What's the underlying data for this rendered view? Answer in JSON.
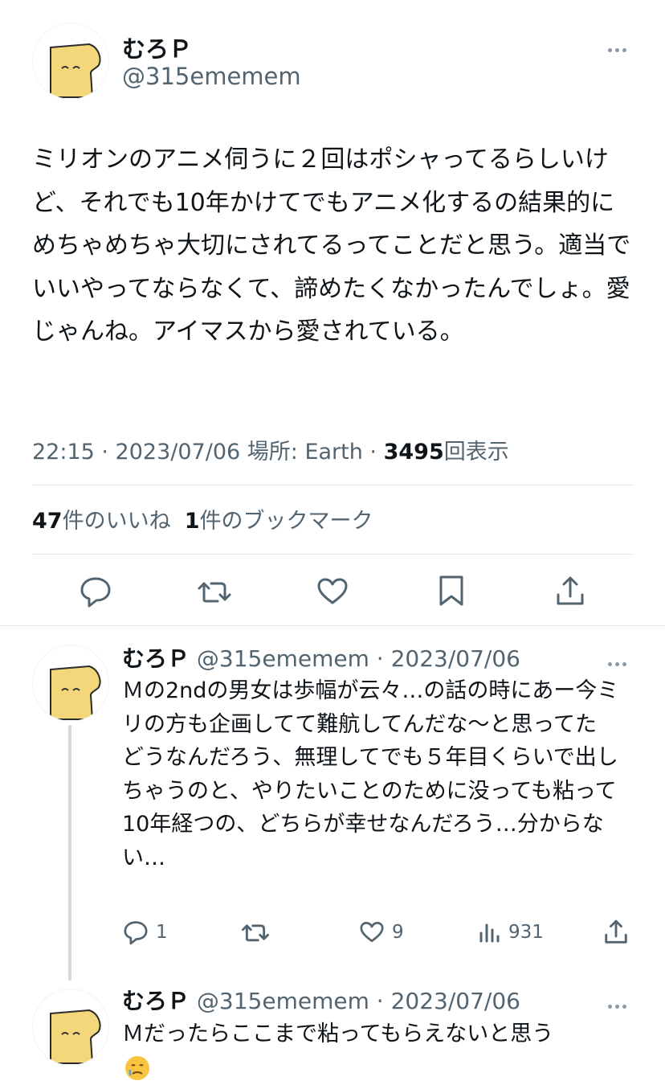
{
  "main_tweet": {
    "name": "むろＰ",
    "handle": "@315ememem",
    "body": "ミリオンのアニメ伺うに２回はポシャってるらしいけど、それでも10年かけてでもアニメ化するの結果的にめちゃめちゃ大切にされてるってことだと思う。適当でいいやってならなくて、諦めたくなかったんでしょ。愛じゃんね。アイマスから愛されている。",
    "meta_prefix": "22:15 · 2023/07/06 場所: Earth · ",
    "views": "3495",
    "views_label": "回表示",
    "likes_count": "47",
    "likes_label": "件のいいね",
    "bookmarks_count": "1",
    "bookmarks_label": "件のブックマーク",
    "actions": [
      "reply-icon",
      "retweet-icon",
      "like-icon",
      "bookmark-icon",
      "share-icon"
    ]
  },
  "replies": [
    {
      "name": "むろＰ",
      "handle": "@315ememem",
      "date": "· 2023/07/06",
      "body": "Ｍの2ndの男女は歩幅が云々…の話の時にあー今ミリの方も企画してて難航してんだな〜と思ってた\nどうなんだろう、無理してでも５年目くらいで出しちゃうのと、やりたいことのために没っても粘って10年経つの、どちらが幸せなんだろう…分からない…",
      "reply_count": "1",
      "like_count": "9",
      "view_count": "931"
    },
    {
      "name": "むろＰ",
      "handle": "@315ememem",
      "date": "· 2023/07/06",
      "body": "Ｍだったらここまで粘ってもらえないと思う"
    }
  ]
}
